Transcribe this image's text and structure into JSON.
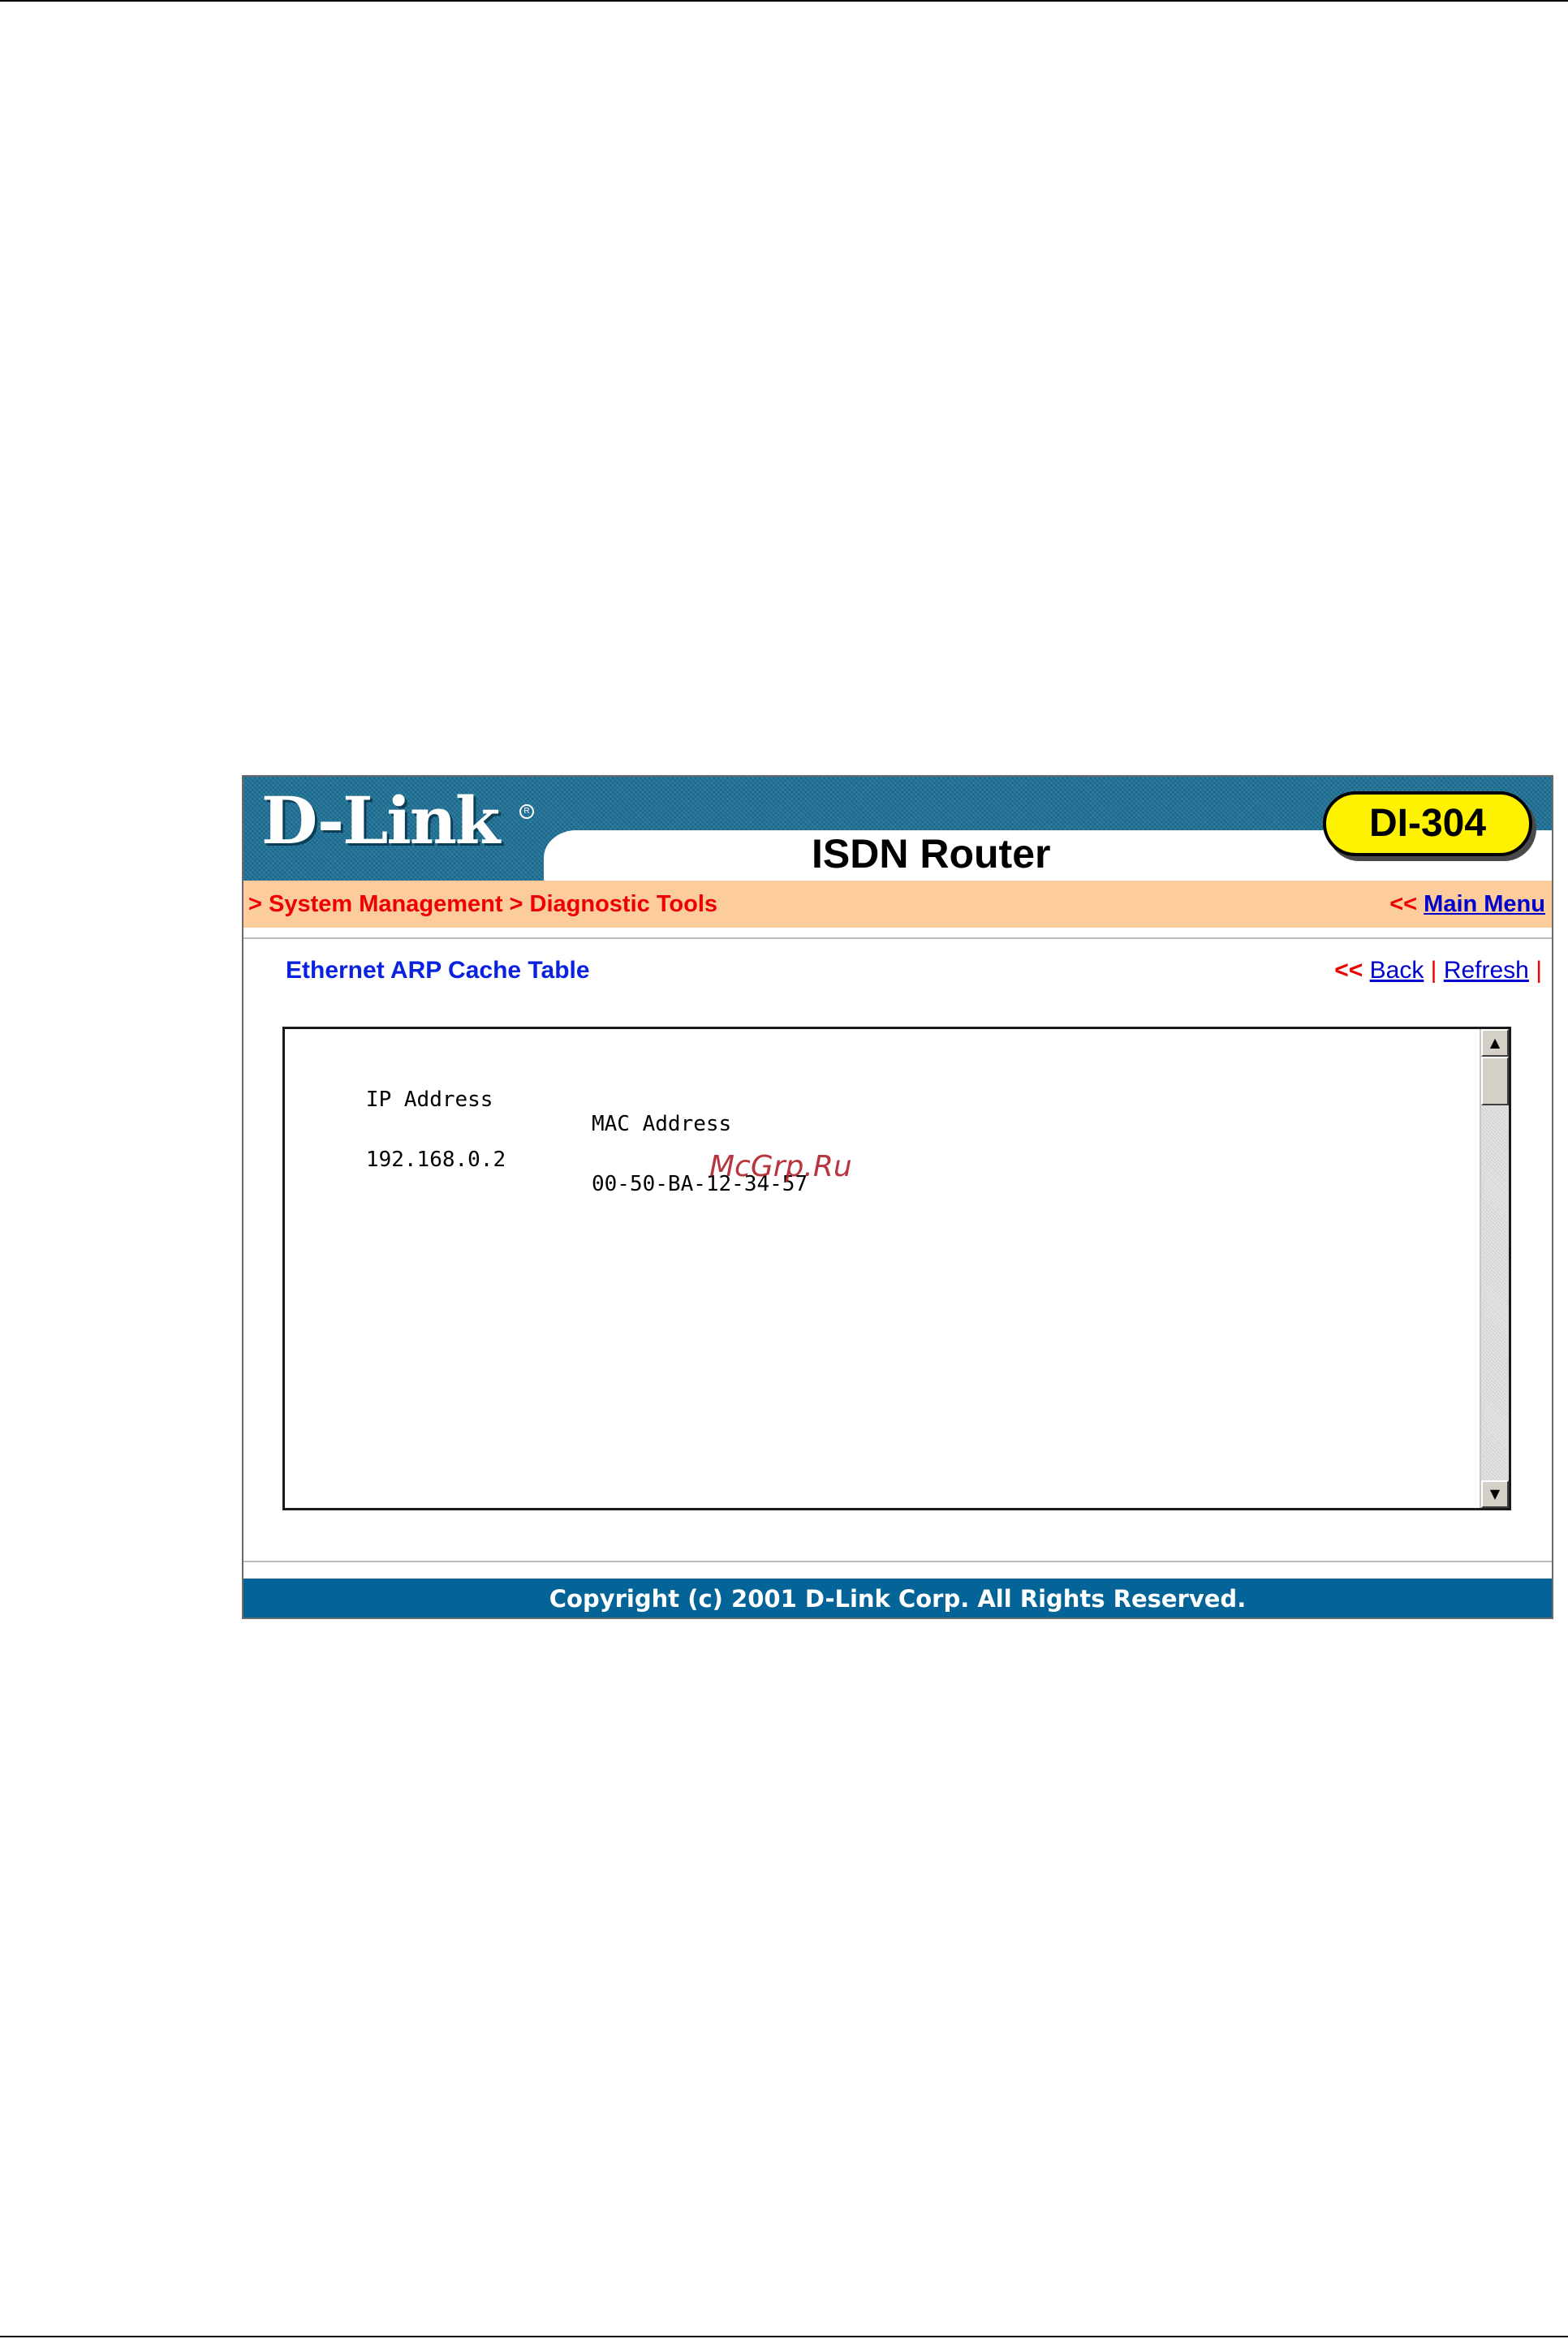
{
  "header": {
    "logo": "D-Link",
    "product_title": "ISDN Router",
    "model": "DI-304"
  },
  "nav": {
    "breadcrumb": "> System Management > Diagnostic Tools",
    "main_menu_arrows": "<<",
    "main_menu_label": "Main Menu"
  },
  "content": {
    "section_title": "Ethernet ARP Cache Table",
    "subnav_arrows": "<<",
    "back_label": "Back",
    "separator": "|",
    "refresh_label": "Refresh",
    "table": {
      "headers": [
        "IP Address",
        "MAC Address"
      ],
      "rows": [
        [
          "192.168.0.2",
          "00-50-BA-12-34-57"
        ]
      ]
    }
  },
  "watermark": "McGrp.Ru",
  "footer": {
    "copyright": "Copyright (c) 2001 D-Link Corp. All Rights Reserved."
  },
  "colors": {
    "header_blue": "#1a6f95",
    "nav_bar": "#fdcc9c",
    "breadcrumb_red": "#ee0000",
    "link_blue": "#0000cc",
    "title_blue": "#0a22e0",
    "badge_yellow": "#fff200",
    "footer_blue": "#046497"
  }
}
